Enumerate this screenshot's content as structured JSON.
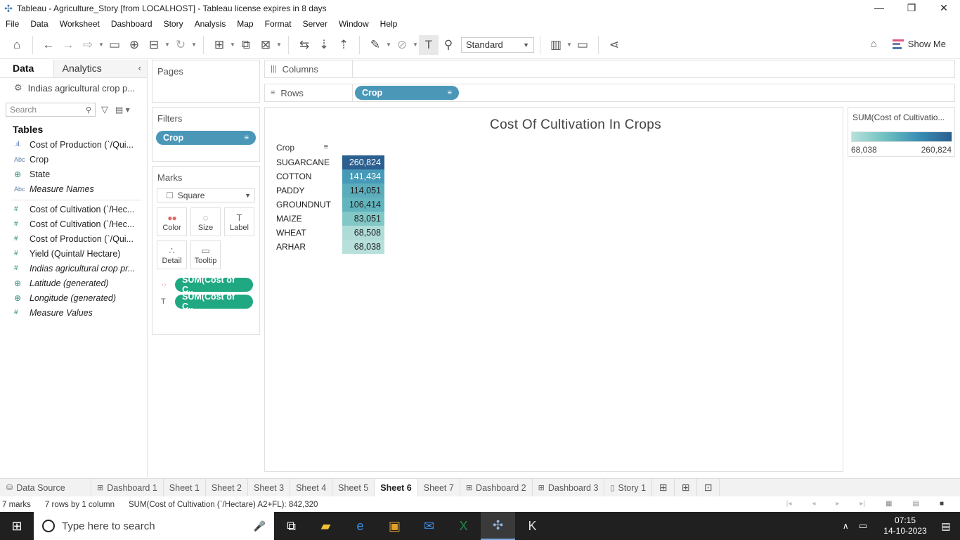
{
  "window": {
    "title": "Tableau - Agriculture_Story [from LOCALHOST] - Tableau license expires in 8 days",
    "controls": [
      "—",
      "❐",
      "✕"
    ]
  },
  "menu": [
    "File",
    "Data",
    "Worksheet",
    "Dashboard",
    "Story",
    "Analysis",
    "Map",
    "Format",
    "Server",
    "Window",
    "Help"
  ],
  "toolbar": {
    "fit_select": "Standard",
    "show_me": "Show Me"
  },
  "data_pane": {
    "tab_data": "Data",
    "tab_analytics": "Analytics",
    "source": "Indias agricultural crop p...",
    "search_placeholder": "Search",
    "tables_heading": "Tables",
    "fields": [
      {
        "icon": "bar",
        "name": "Cost of Production (`/Qui...",
        "italic": false
      },
      {
        "icon": "abc",
        "name": "Crop",
        "italic": false
      },
      {
        "icon": "globe",
        "name": "State",
        "italic": false
      },
      {
        "icon": "abc",
        "name": "Measure Names",
        "italic": true
      },
      {
        "icon": "hash",
        "name": "Cost of Cultivation (`/Hec...",
        "italic": false
      },
      {
        "icon": "hash",
        "name": "Cost of Cultivation (`/Hec...",
        "italic": false
      },
      {
        "icon": "hash",
        "name": "Cost of Production (`/Qui...",
        "italic": false
      },
      {
        "icon": "hash",
        "name": "Yield (Quintal/ Hectare)",
        "italic": false
      },
      {
        "icon": "hash",
        "name": "Indias agricultural crop pr...",
        "italic": true
      },
      {
        "icon": "globe",
        "name": "Latitude (generated)",
        "italic": true
      },
      {
        "icon": "globe",
        "name": "Longitude (generated)",
        "italic": true
      },
      {
        "icon": "hash",
        "name": "Measure Values",
        "italic": true
      }
    ]
  },
  "pages_card": {
    "title": "Pages"
  },
  "filters_card": {
    "title": "Filters",
    "pill": "Crop"
  },
  "marks_card": {
    "title": "Marks",
    "mark_type": "Square",
    "buttons": [
      "Color",
      "Size",
      "Label",
      "Detail",
      "Tooltip"
    ],
    "color_pill": "SUM(Cost of C..",
    "label_pill": "SUM(Cost of C.."
  },
  "shelves": {
    "columns_label": "Columns",
    "rows_label": "Rows",
    "rows_pill": "Crop"
  },
  "view": {
    "title": "Cost Of Cultivation In Crops",
    "row_header": "Crop"
  },
  "chart_data": {
    "type": "heatmap",
    "title": "Cost Of Cultivation In Crops",
    "row_field": "Crop",
    "categories": [
      "SUGARCANE",
      "COTTON",
      "PADDY",
      "GROUNDNUT",
      "MAIZE",
      "WHEAT",
      "ARHAR"
    ],
    "labels": [
      "260,824",
      "141,434",
      "114,051",
      "106,414",
      "83,051",
      "68,508",
      "68,038"
    ],
    "values": [
      260824,
      141434,
      114051,
      106414,
      83051,
      68508,
      68038
    ],
    "color_range": [
      68038,
      260824
    ],
    "color_low": "#b8e0db",
    "color_high": "#2a5f8f"
  },
  "legend": {
    "title": "SUM(Cost of Cultivatio...",
    "min_label": "68,038",
    "max_label": "260,824"
  },
  "sheet_tabs": [
    {
      "label": "Data Source",
      "icon": "db",
      "active": false
    },
    {
      "label": "Dashboard 1",
      "icon": "dash",
      "active": false
    },
    {
      "label": "Sheet 1",
      "icon": "",
      "active": false
    },
    {
      "label": "Sheet 2",
      "icon": "",
      "active": false
    },
    {
      "label": "Sheet 3",
      "icon": "",
      "active": false
    },
    {
      "label": "Sheet 4",
      "icon": "",
      "active": false
    },
    {
      "label": "Sheet 5",
      "icon": "",
      "active": false
    },
    {
      "label": "Sheet 6",
      "icon": "",
      "active": true
    },
    {
      "label": "Sheet 7",
      "icon": "",
      "active": false
    },
    {
      "label": "Dashboard 2",
      "icon": "dash",
      "active": false
    },
    {
      "label": "Dashboard 3",
      "icon": "dash",
      "active": false
    },
    {
      "label": "Story 1",
      "icon": "story",
      "active": false
    }
  ],
  "status": {
    "marks": "7 marks",
    "dims": "7 rows by 1 column",
    "sum": "SUM(Cost of Cultivation (`/Hectare) A2+FL): 842,320"
  },
  "taskbar": {
    "search_placeholder": "Type here to search",
    "time": "07:15",
    "date": "14-10-2023"
  }
}
